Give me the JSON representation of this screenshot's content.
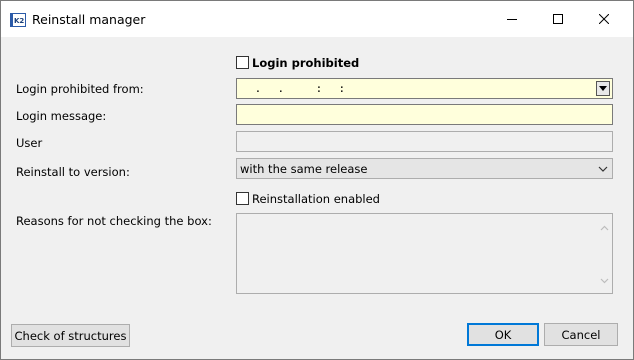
{
  "window": {
    "title": "Reinstall manager",
    "app_icon": "k2-app-icon"
  },
  "form": {
    "login_prohibited_checkbox": {
      "label": "Login prohibited",
      "checked": false
    },
    "login_prohibited_from": {
      "label": "Login prohibited from:",
      "value": " .  .    :  :"
    },
    "login_message": {
      "label": "Login message:",
      "value": ""
    },
    "user": {
      "label": "User",
      "value": ""
    },
    "reinstall_to_version": {
      "label": "Reinstall to version:",
      "value": "with the same release"
    },
    "reinstallation_enabled_checkbox": {
      "label": "Reinstallation enabled",
      "checked": false
    },
    "reasons": {
      "label": "Reasons for not checking the box:",
      "value": ""
    }
  },
  "buttons": {
    "check_structures": "Check of structures",
    "ok": "OK",
    "cancel": "Cancel"
  },
  "colors": {
    "input_highlight": "#ffffdc",
    "default_button_border": "#0078d7",
    "dialog_background": "#f0f0f0"
  }
}
